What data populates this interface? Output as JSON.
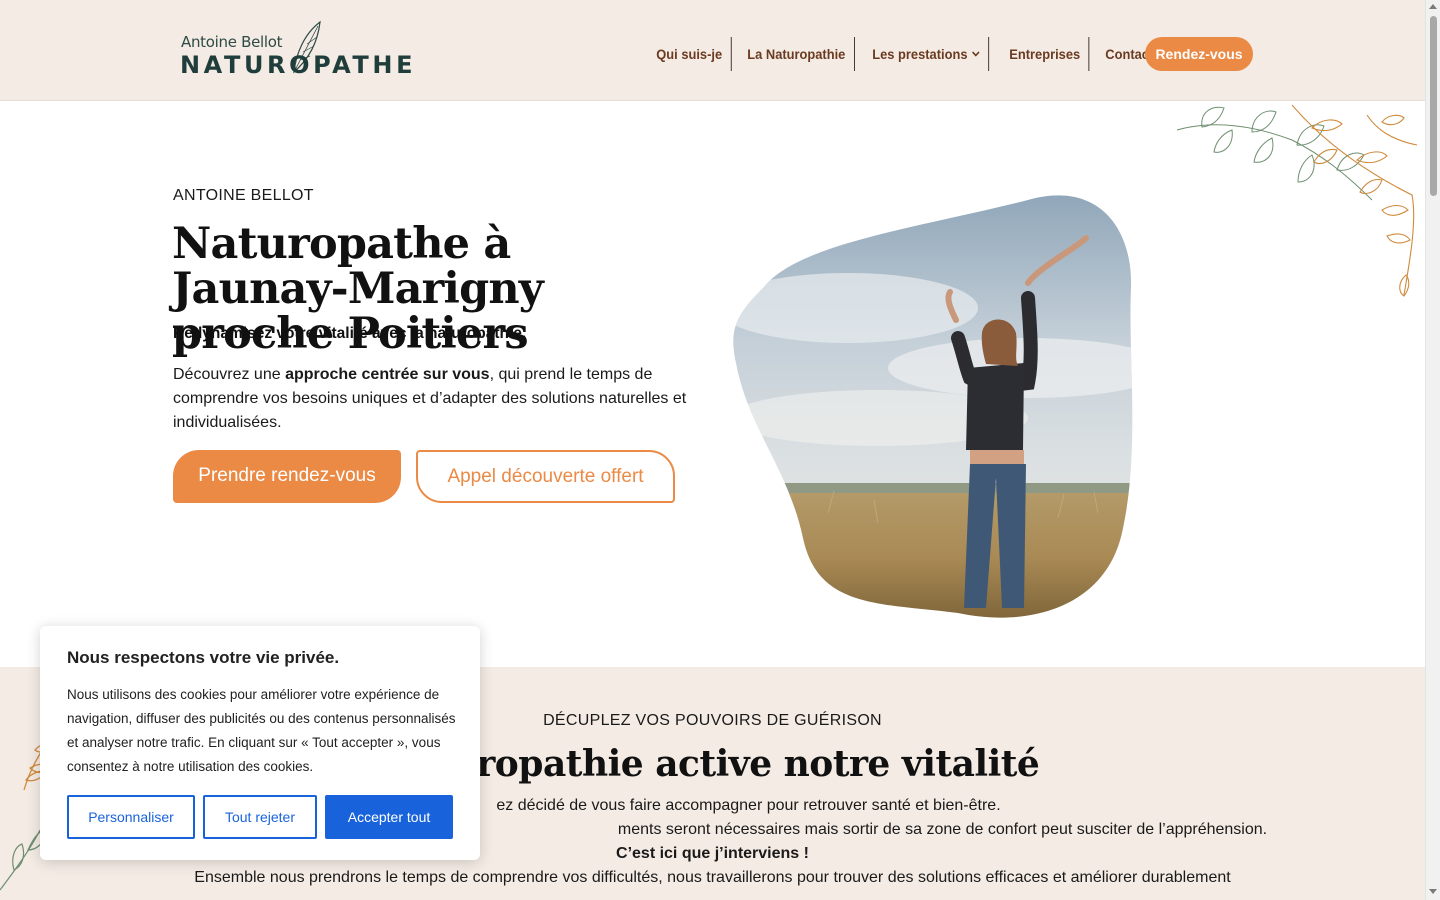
{
  "header": {
    "logo": {
      "small_text": "Antoine Bellot",
      "big_text": "NATUROPATHE"
    },
    "nav": [
      {
        "label": "Qui suis-je"
      },
      {
        "label": "La Naturopathie"
      },
      {
        "label": "Les prestations",
        "has_dropdown": true
      },
      {
        "label": "Entreprises"
      },
      {
        "label": "Contact"
      }
    ],
    "cta_label": "Rendez-vous"
  },
  "hero": {
    "eyebrow": "ANTOINE BELLOT",
    "title": "Naturopathe à Jaunay-Marigny proche Poitiers",
    "subtitle": "Redynamisez votre vitalité avec la naturopathie.",
    "text_before": "Découvrez une ",
    "text_bold": "approche centrée sur vous",
    "text_after": ", qui prend le temps de comprendre vos besoins uniques et d’adapter des solutions naturelles et individualisées.",
    "primary_button": "Prendre rendez-vous",
    "secondary_button": "Appel découverte offert"
  },
  "section2": {
    "eyebrow": "DÉCUPLEZ VOS POUVOIRS DE GUÉRISON",
    "title_visible": "aturopathie active notre vitalité",
    "line1_visible": "ez décidé de vous faire accompagner pour retrouver santé et bien-être.",
    "line2_visible": "ments seront nécessaires mais sortir de sa zone de confort peut susciter de l’appréhension.",
    "line3": "C’est ici que j’interviens !",
    "line4": "Ensemble nous prendrons le temps de comprendre vos difficultés, nous travaillerons pour trouver des solutions efficaces et améliorer durablement"
  },
  "cookie_banner": {
    "title": "Nous respectons votre vie privée.",
    "text": "Nous utilisons des cookies pour améliorer votre expérience de navigation, diffuser des publicités ou des contenus personnalisés et analyser notre trafic. En cliquant sur « Tout accepter », vous consentez à notre utilisation des cookies.",
    "customize_label": "Personnaliser",
    "reject_label": "Tout rejeter",
    "accept_label": "Accepter tout"
  },
  "colors": {
    "accent": "#eb8a45",
    "header_bg": "#f4ebe4",
    "nav_text": "#6a3a21",
    "cookie_blue": "#1863dc",
    "logo_green": "#1f3d3a"
  },
  "icons": [
    "leaf-logo-icon",
    "chevron-down-icon",
    "leaf-decoration"
  ]
}
